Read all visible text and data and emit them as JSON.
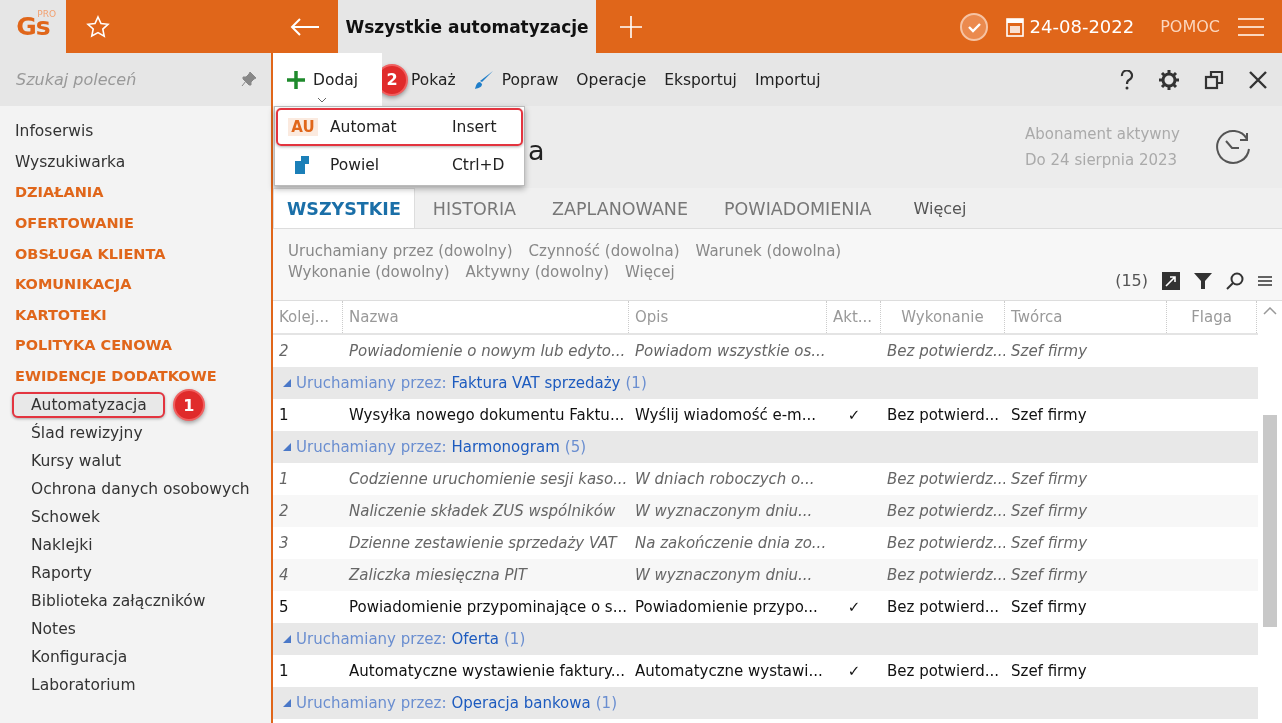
{
  "topbar": {
    "logo": "Gs",
    "logo_badge": "PRO",
    "tab_title": "Wszystkie automatyzacje",
    "date": "24-08-2022",
    "help": "POMOC"
  },
  "sidebar": {
    "search_placeholder": "Szukaj poleceń",
    "items": [
      {
        "label": "Infoserwis",
        "kind": "link"
      },
      {
        "label": "Wyszukiwarka",
        "kind": "link"
      },
      {
        "label": "DZIAŁANIA",
        "kind": "section"
      },
      {
        "label": "OFERTOWANIE",
        "kind": "section"
      },
      {
        "label": "OBSŁUGA KLIENTA",
        "kind": "section"
      },
      {
        "label": "KOMUNIKACJA",
        "kind": "section"
      },
      {
        "label": "KARTOTEKI",
        "kind": "section"
      },
      {
        "label": "POLITYKA CENOWA",
        "kind": "section"
      },
      {
        "label": "EWIDENCJE DODATKOWE",
        "kind": "section",
        "children": [
          {
            "label": "Automatyzacja",
            "selected": true,
            "callout": "1"
          },
          {
            "label": "Ślad rewizyjny",
            "selected": false
          },
          {
            "label": "Kursy walut",
            "selected": false
          },
          {
            "label": "Ochrona danych osobowych",
            "selected": false
          },
          {
            "label": "Schowek",
            "selected": false
          },
          {
            "label": "Naklejki",
            "selected": false
          },
          {
            "label": "Raporty",
            "selected": false
          },
          {
            "label": "Biblioteka załączników",
            "selected": false
          },
          {
            "label": "Notes",
            "selected": false
          },
          {
            "label": "Konfiguracja",
            "selected": false
          },
          {
            "label": "Laboratorium",
            "selected": false
          }
        ]
      }
    ]
  },
  "toolbar": {
    "items": [
      {
        "label": "Dodaj",
        "kind": "add"
      },
      {
        "label": "Pokaż",
        "kind": "show",
        "callout": "2"
      },
      {
        "label": "Popraw",
        "kind": "edit"
      },
      {
        "label": "Operacje",
        "kind": "plain"
      },
      {
        "label": "Eksportuj",
        "kind": "plain"
      },
      {
        "label": "Importuj",
        "kind": "plain"
      }
    ]
  },
  "dropdown": {
    "items": [
      {
        "icon_text": "AU",
        "label": "Automat",
        "shortcut": "Insert",
        "highlighted": true
      },
      {
        "label": "Powiel",
        "shortcut": "Ctrl+D",
        "highlighted": false
      }
    ]
  },
  "header": {
    "title_visible": "a",
    "subscription": "Abonament aktywny",
    "until": "Do 24 sierpnia 2023"
  },
  "tabs": [
    {
      "label": "WSZYSTKIE",
      "selected": true
    },
    {
      "label": "HISTORIA",
      "selected": false
    },
    {
      "label": "ZAPLANOWANE",
      "selected": false
    },
    {
      "label": "POWIADOMIENIA",
      "selected": false
    },
    {
      "label": "Więcej",
      "selected": false
    }
  ],
  "filters": [
    "Uruchamiany przez (dowolny)",
    "Czynność (dowolna)",
    "Warunek (dowolna)",
    "Wykonanie (dowolny)",
    "Aktywny (dowolny)",
    "Więcej"
  ],
  "count": "(15)",
  "table": {
    "columns": [
      "Kolej...",
      "Nazwa",
      "Opis",
      "Akt...",
      "Wykonanie",
      "Twórca",
      "Flaga"
    ],
    "rows": [
      {
        "kind": "item",
        "active": false,
        "cells": [
          "2",
          "Powiadomienie o nowym lub edyto...",
          "Powiadom wszystkie os...",
          "",
          "Bez potwierdz...",
          "Szef firmy",
          ""
        ]
      },
      {
        "kind": "group",
        "expanded": true,
        "prefix": "Uruchamiany przez:",
        "name": "Faktura VAT sprzedaży",
        "count": "(1)"
      },
      {
        "kind": "item",
        "active": true,
        "cells": [
          "1",
          "Wysyłka nowego dokumentu Faktu...",
          "Wyślij wiadomość e-m...",
          "✓",
          "Bez potwierd...",
          "Szef firmy",
          ""
        ]
      },
      {
        "kind": "group",
        "expanded": true,
        "prefix": "Uruchamiany przez:",
        "name": "Harmonogram",
        "count": "(5)"
      },
      {
        "kind": "item",
        "active": false,
        "cells": [
          "1",
          "Codzienne uruchomienie sesji kaso...",
          "W dniach roboczych o...",
          "",
          "Bez potwierdz...",
          "Szef firmy",
          ""
        ]
      },
      {
        "kind": "item",
        "active": false,
        "cells": [
          "2",
          "Naliczenie składek ZUS wspólników",
          "W wyznaczonym dniu...",
          "",
          "Bez potwierdz...",
          "Szef firmy",
          ""
        ]
      },
      {
        "kind": "item",
        "active": false,
        "cells": [
          "3",
          "Dzienne zestawienie sprzedaży VAT",
          "Na zakończenie dnia zo...",
          "",
          "Bez potwierdz...",
          "Szef firmy",
          ""
        ]
      },
      {
        "kind": "item",
        "active": false,
        "cells": [
          "4",
          "Zaliczka miesięczna PIT",
          "W wyznaczonym dniu...",
          "",
          "Bez potwierdz...",
          "Szef firmy",
          ""
        ]
      },
      {
        "kind": "item",
        "active": true,
        "cells": [
          "5",
          "Powiadomienie przypominające o s...",
          "Powiadomienie przypo...",
          "✓",
          "Bez potwierd...",
          "Szef firmy",
          ""
        ]
      },
      {
        "kind": "group",
        "expanded": true,
        "prefix": "Uruchamiany przez:",
        "name": "Oferta",
        "count": "(1)"
      },
      {
        "kind": "item",
        "active": true,
        "cells": [
          "1",
          "Automatyczne wystawienie faktury...",
          "Automatyczne wystawi...",
          "✓",
          "Bez potwierd...",
          "Szef firmy",
          ""
        ]
      },
      {
        "kind": "group",
        "expanded": true,
        "prefix": "Uruchamiany przez:",
        "name": "Operacja bankowa",
        "count": "(1)"
      }
    ]
  }
}
